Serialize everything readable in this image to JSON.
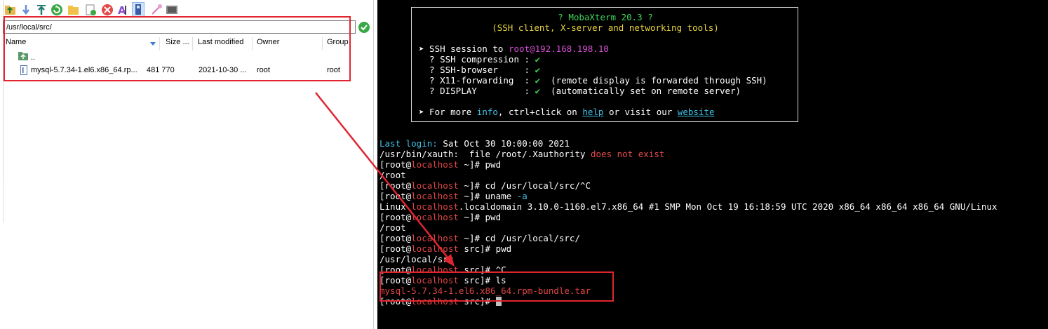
{
  "sftp": {
    "path": "/usr/local/src/",
    "columns": [
      "Name",
      "Size ...",
      "Last modified",
      "Owner",
      "Group"
    ],
    "rows": [
      {
        "name": "..",
        "size": "",
        "modified": "",
        "owner": "",
        "group": ""
      },
      {
        "name": "mysql-5.7.34-1.el6.x86_64.rp...",
        "size": "481 770",
        "modified": "2021-10-30 ...",
        "owner": "root",
        "group": "root"
      }
    ],
    "toolbar_icons": [
      "folder-up-icon",
      "download-icon",
      "upload-icon",
      "refresh-icon",
      "new-folder-icon",
      "new-file-icon",
      "delete-icon",
      "rename-icon",
      "terminal-follow-icon",
      "permissions-icon",
      "terminal-icon"
    ]
  },
  "banner": {
    "title": "? MobaXterm 20.3 ?",
    "subtitle": "(SSH client, X-server and networking tools)",
    "session_prefix": "➤ SSH session to ",
    "session_user": "root",
    "session_host": "@192.168.198.10",
    "opt1": "  ? SSH compression : ",
    "opt2": "  ? SSH-browser     : ",
    "opt3": "  ? X11-forwarding  : ",
    "opt3_note": "  (remote display is forwarded through SSH)",
    "opt4": "  ? DISPLAY         : ",
    "opt4_note": "  (automatically set on remote server)",
    "check": "✔",
    "more_1": "➤ For more ",
    "more_info": "info",
    "more_2": ", ctrl+click on ",
    "more_help": "help",
    "more_3": " or visit our ",
    "more_website": "website"
  },
  "terminal": {
    "last_login_label": "Last login:",
    "last_login_value": " Sat Oct 30 10:00:00 2021",
    "xauth_prefix": "/usr/bin/xauth:  file /root/.Xauthority ",
    "xauth_error": "does not exist",
    "prompt_open": "[root@",
    "prompt_host": "localhost",
    "cmd_pwd1": " ~]# pwd",
    "out_root1": "/root",
    "cmd_cd1": " ~]# cd /usr/local/src/^C",
    "cmd_uname": " ~]# uname ",
    "cmd_uname_flag": "-a",
    "out_linux_1": "Linux ",
    "out_linux_host": "localhost",
    "out_linux_2": ".localdomain 3.10.0-1160.el7.x86_64 #1 SMP Mon Oct 19 16:18:59 UTC 2020 x86_64 x86_64 x86_64 GNU/Linux",
    "cmd_pwd2": " ~]# pwd",
    "out_root2": "/root",
    "cmd_cd2": " ~]# cd /usr/local/src/",
    "cmd_pwd3": " src]# pwd",
    "out_src": "/usr/local/src",
    "cmd_ctrlc": " src]# ^C",
    "cmd_ls": " src]# ls",
    "out_ls_file": "mysql-5.7.34-1.el6.x86_64.rpm-bundle.tar",
    "cmd_last": " src]# "
  },
  "colors": {
    "annotation": "#e0252f",
    "terminal_bg": "#000000",
    "cyan": "#3ec1e6",
    "magenta": "#d64fd6",
    "host_red": "#e04646"
  }
}
